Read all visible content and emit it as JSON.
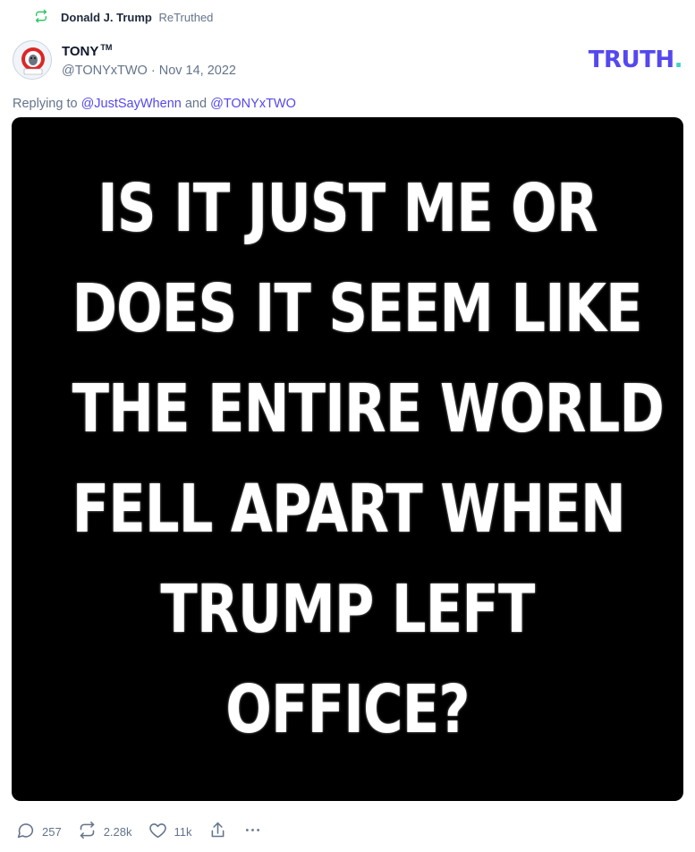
{
  "retruth": {
    "name": "Donald J. Trump",
    "label": "ReTruthed",
    "icon": "retruth-icon",
    "icon_color": "#22c55e"
  },
  "post": {
    "author": {
      "display_name": "TONY",
      "badge": "TM",
      "handle": "@TONYxTWO",
      "separator": "·",
      "date": "Nov 14, 2022",
      "avatar_icon": "lion-maga-avatar",
      "avatar_text": "MAGA"
    },
    "reply": {
      "prefix": "Replying to",
      "mention_1": "@JustSayWhenn",
      "conjunction": "and",
      "mention_2": "@TONYxTWO"
    },
    "image_text_lines": [
      "IS IT JUST ME OR",
      "DOES IT SEEM LIKE",
      "THE ENTIRE WORLD",
      "FELL APART WHEN",
      "TRUMP LEFT",
      "OFFICE?"
    ]
  },
  "brand": {
    "logo_text": "TRUTH",
    "logo_dot": ".",
    "primary_color": "#5448ee",
    "accent_color": "#3bd3c4"
  },
  "actions": {
    "replies": "257",
    "retruths": "2.28k",
    "likes": "11k",
    "icons": [
      "reply-icon",
      "retruth-icon",
      "heart-icon",
      "share-icon",
      "more-icon"
    ]
  }
}
